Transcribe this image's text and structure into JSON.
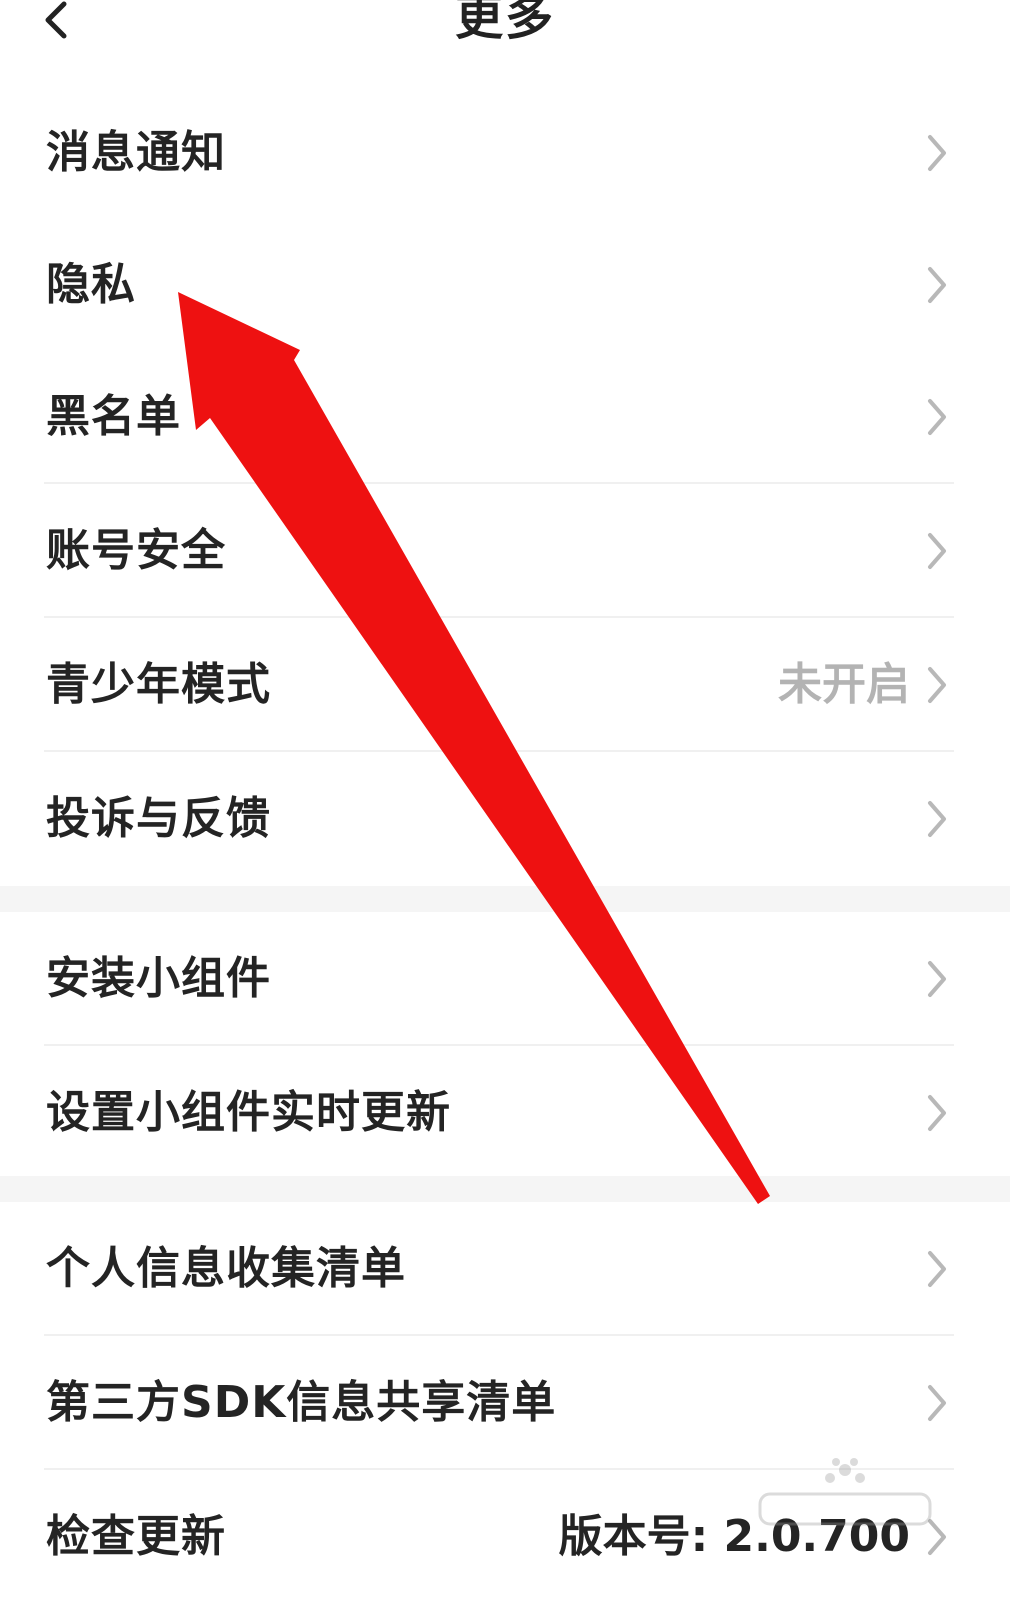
{
  "header": {
    "title": "更多"
  },
  "menu": [
    {
      "label": "消息通知",
      "value": ""
    },
    {
      "label": "隐私",
      "value": ""
    },
    {
      "label": "黑名单",
      "value": ""
    },
    {
      "label": "账号安全",
      "value": ""
    },
    {
      "label": "青少年模式",
      "value": "未开启"
    },
    {
      "label": "投诉与反馈",
      "value": ""
    },
    {
      "label": "安装小组件",
      "value": ""
    },
    {
      "label": "设置小组件实时更新",
      "value": ""
    },
    {
      "label": "个人信息收集清单",
      "value": ""
    },
    {
      "label": "第三方SDK信息共享清单",
      "value": ""
    },
    {
      "label": "检查更新",
      "value": "版本号: 2.0.700"
    }
  ],
  "annotation": {
    "arrow_color": "#ee1111"
  },
  "icons": {
    "back": "back-chevron-icon",
    "row": "chevron-right-icon"
  }
}
